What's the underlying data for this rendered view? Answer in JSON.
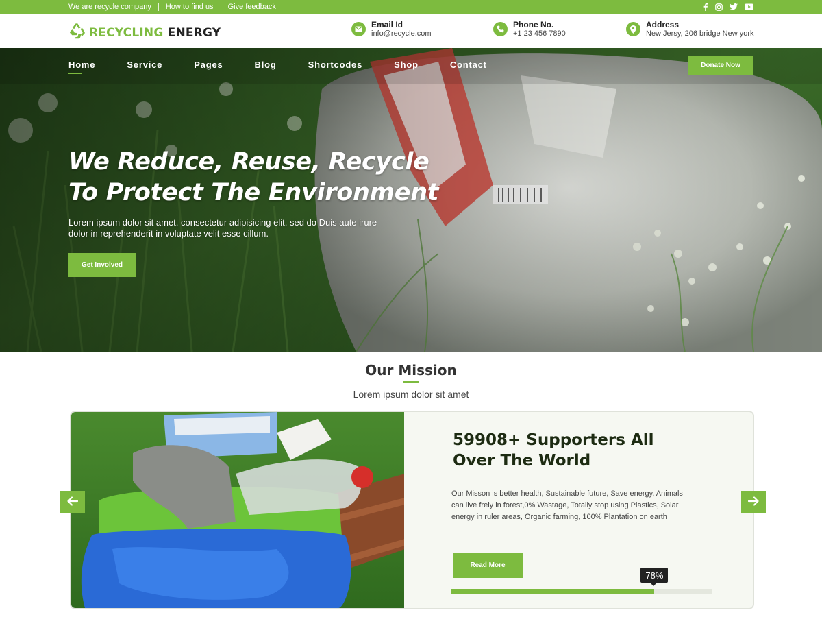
{
  "topbar": {
    "links": [
      "We are recycle company",
      "How to find us",
      "Give feedback"
    ],
    "social_icons": [
      "facebook-icon",
      "instagram-icon",
      "twitter-icon",
      "youtube-icon"
    ]
  },
  "header": {
    "logo": {
      "part1": "RECYCLING",
      "part2": "ENERGY",
      "icon": "recycle-icon"
    },
    "contacts": [
      {
        "title": "Email Id",
        "value": "info@recycle.com",
        "icon": "email-icon"
      },
      {
        "title": "Phone No.",
        "value": "+1 23 456 7890",
        "icon": "phone-icon"
      },
      {
        "title": "Address",
        "value": "New Jersy, 206 bridge New york",
        "icon": "location-icon"
      }
    ]
  },
  "nav": {
    "items": [
      "Home",
      "Service",
      "Pages",
      "Blog",
      "Shortcodes",
      "Shop",
      "Contact"
    ],
    "active": "Home",
    "donate_label": "Donate Now"
  },
  "hero": {
    "title_line1": "We Reduce, Reuse, Recycle",
    "title_line2": "To Protect The Environment",
    "subtitle": "Lorem ipsum dolor sit amet, consectetur adipisicing elit, sed do Duis aute irure dolor in reprehenderit in voluptate velit esse cillum.",
    "cta_label": "Get Involved"
  },
  "mission": {
    "title": "Our Mission",
    "subtitle": "Lorem ipsum dolor sit amet",
    "card": {
      "heading": "59908+ Supporters All Over The World",
      "text": "Our Misson is better health, Sustainable future, Save energy, Animals can live frely in forest,0% Wastage, Totally stop using Plastics, Solar energy in ruler areas, Organic farming, 100% Plantation on earth",
      "button_label": "Read More",
      "progress_percent": 78,
      "progress_label": "78%"
    }
  },
  "colors": {
    "accent": "#7dbb3f",
    "dark": "#222222"
  }
}
